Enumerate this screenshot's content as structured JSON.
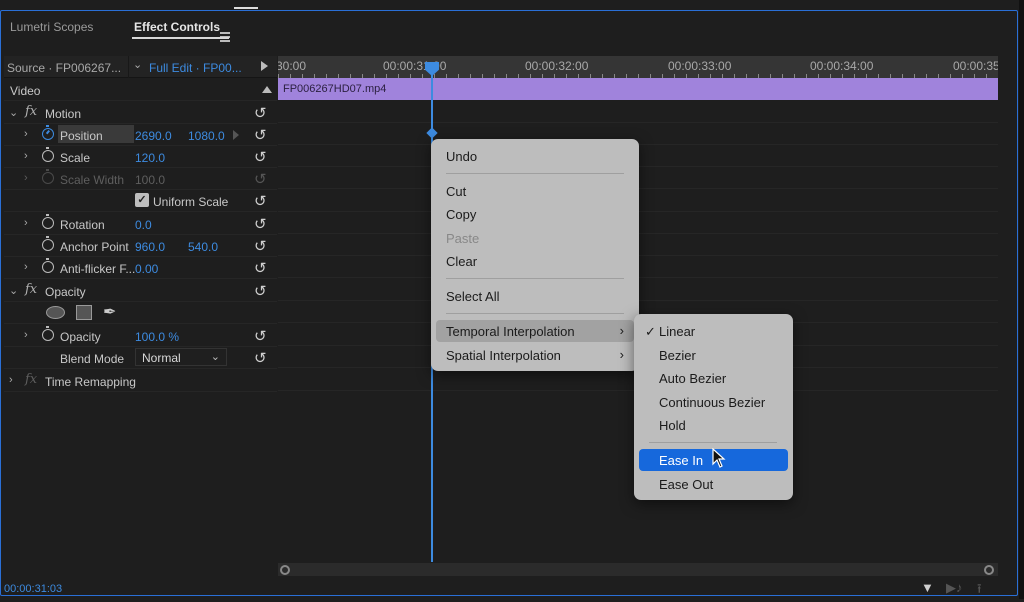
{
  "tabs": [
    {
      "label": "Lumetri Scopes",
      "active": false
    },
    {
      "label": "Effect Controls",
      "active": true
    }
  ],
  "source_bar": {
    "source": "Source · FP006267...",
    "sequence": "Full Edit · FP00..."
  },
  "effects": {
    "video_label": "Video",
    "motion": {
      "label": "Motion",
      "position": {
        "label": "Position",
        "x": "2690.0",
        "y": "1080.0"
      },
      "scale": {
        "label": "Scale",
        "value": "120.0"
      },
      "scale_width": {
        "label": "Scale Width",
        "value": "100.0"
      },
      "uniform_scale": {
        "label": "Uniform Scale",
        "checked": true
      },
      "rotation": {
        "label": "Rotation",
        "value": "0.0"
      },
      "anchor_point": {
        "label": "Anchor Point",
        "x": "960.0",
        "y": "540.0"
      },
      "anti_flicker": {
        "label": "Anti-flicker F...",
        "value": "0.00"
      }
    },
    "opacity": {
      "label": "Opacity",
      "opacity_value": {
        "label": "Opacity",
        "value": "100.0 %"
      },
      "blend_mode": {
        "label": "Blend Mode",
        "value": "Normal"
      }
    },
    "time_remapping": {
      "label": "Time Remapping"
    }
  },
  "timeline": {
    "ruler_labels": [
      "30:00",
      "00:00:31:00",
      "00:00:32:00",
      "00:00:33:00",
      "00:00:34:00",
      "00:00:35"
    ],
    "clip_name": "FP006267HD07.mp4",
    "playhead_color": "#3d8be0",
    "clip_color": "#a083dc"
  },
  "current_timecode": "00:00:31:03",
  "context_menu": {
    "items": [
      {
        "label": "Undo",
        "enabled": true
      },
      {
        "label": "Cut",
        "enabled": true
      },
      {
        "label": "Copy",
        "enabled": true
      },
      {
        "label": "Paste",
        "enabled": false
      },
      {
        "label": "Clear",
        "enabled": true
      },
      {
        "label": "Select All",
        "enabled": true
      },
      {
        "label": "Temporal Interpolation",
        "enabled": true,
        "submenu": true,
        "highlighted": true
      },
      {
        "label": "Spatial Interpolation",
        "enabled": true,
        "submenu": true
      }
    ]
  },
  "submenu": {
    "items": [
      {
        "label": "Linear",
        "checked": true
      },
      {
        "label": "Bezier"
      },
      {
        "label": "Auto Bezier"
      },
      {
        "label": "Continuous Bezier"
      },
      {
        "label": "Hold"
      },
      {
        "label": "Ease In",
        "selected": true
      },
      {
        "label": "Ease Out"
      }
    ],
    "check_glyph": "✓",
    "selected_color": "#1668dc"
  },
  "glyphs": {
    "chevron_right": "›",
    "chevron_down": "⌄",
    "reset": "↺",
    "fx": "fx",
    "pen": "✒",
    "submenu_arrow": "›",
    "filter": "▼",
    "play_audio": "▶♪",
    "export": "⭱"
  }
}
